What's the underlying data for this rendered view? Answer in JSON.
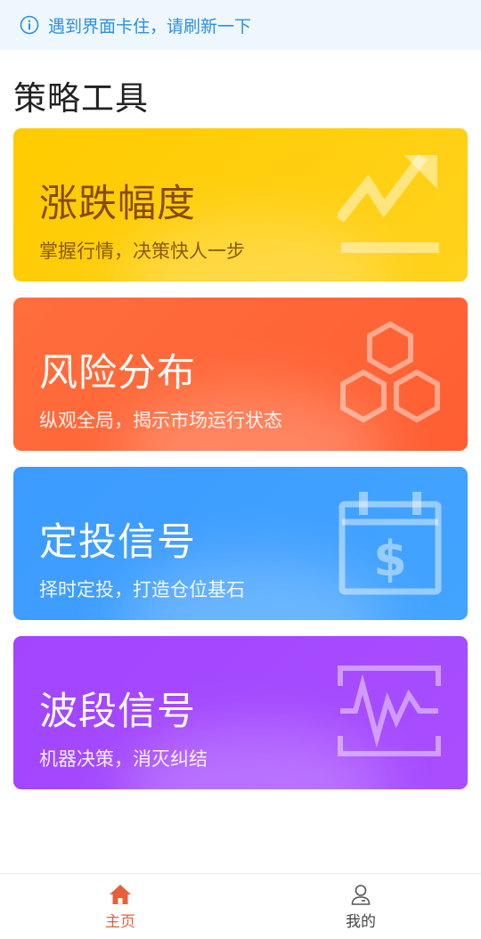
{
  "notice": {
    "text": "遇到界面卡住，请刷新一下",
    "icon": "info-icon",
    "color": "#2c8fe0"
  },
  "page_title": "策略工具",
  "cards": [
    {
      "title": "涨跌幅度",
      "subtitle": "掌握行情，决策快人一步",
      "icon": "trend-chart-icon",
      "color": "#ffcb00"
    },
    {
      "title": "风险分布",
      "subtitle": "纵观全局，揭示市场运行状态",
      "icon": "hexagons-icon",
      "color": "#ff6437"
    },
    {
      "title": "定投信号",
      "subtitle": "择时定投，打造仓位基石",
      "icon": "calendar-dollar-icon",
      "color": "#3f9fff"
    },
    {
      "title": "波段信号",
      "subtitle": "机器决策，消灭纠结",
      "icon": "waveform-icon",
      "color": "#a44aff"
    }
  ],
  "tabbar": {
    "items": [
      {
        "label": "主页",
        "icon": "home-icon",
        "active": true,
        "color": "#e5603a"
      },
      {
        "label": "我的",
        "icon": "user-icon",
        "active": false,
        "color": "#444444"
      }
    ]
  }
}
